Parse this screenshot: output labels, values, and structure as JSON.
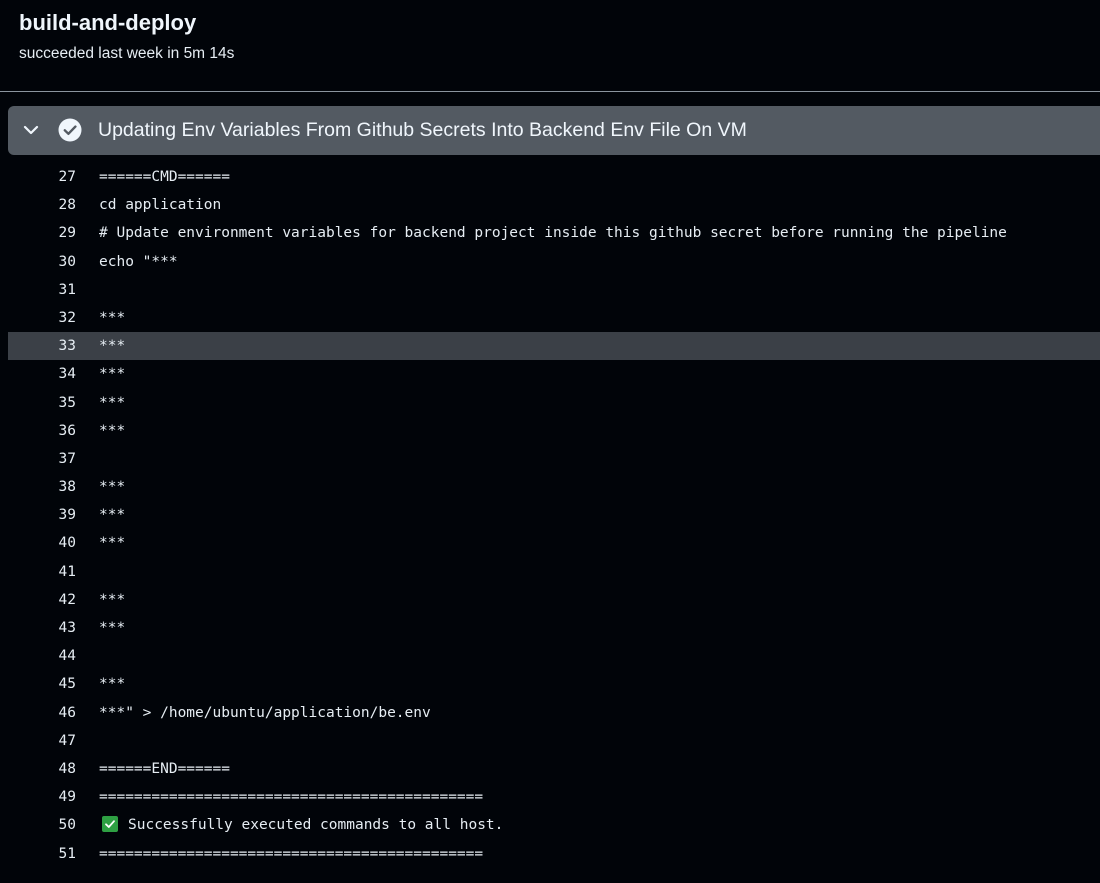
{
  "job": {
    "title": "build-and-deploy",
    "status": "succeeded last week in 5m 14s"
  },
  "step": {
    "title": "Updating Env Variables From Github Secrets Into Backend Env File On VM",
    "status_icon": "check-circle-icon",
    "expand_icon": "chevron-down-icon"
  },
  "colors": {
    "background": "#010409",
    "step_header": "#535a62",
    "highlight_row": "#3b4047",
    "success_green": "#2ea043"
  },
  "log": {
    "lines": [
      {
        "num": "27",
        "text": "======CMD======"
      },
      {
        "num": "28",
        "text": "cd application"
      },
      {
        "num": "29",
        "text": "# Update environment variables for backend project inside this github secret before running the pipeline"
      },
      {
        "num": "30",
        "text": "echo \"***"
      },
      {
        "num": "31",
        "text": ""
      },
      {
        "num": "32",
        "text": "***"
      },
      {
        "num": "33",
        "text": "***"
      },
      {
        "num": "34",
        "text": "***"
      },
      {
        "num": "35",
        "text": "***"
      },
      {
        "num": "36",
        "text": "***"
      },
      {
        "num": "37",
        "text": ""
      },
      {
        "num": "38",
        "text": "***"
      },
      {
        "num": "39",
        "text": "***"
      },
      {
        "num": "40",
        "text": "***"
      },
      {
        "num": "41",
        "text": ""
      },
      {
        "num": "42",
        "text": "***"
      },
      {
        "num": "43",
        "text": "***"
      },
      {
        "num": "44",
        "text": ""
      },
      {
        "num": "45",
        "text": "***"
      },
      {
        "num": "46",
        "text": "***\" > /home/ubuntu/application/be.env"
      },
      {
        "num": "47",
        "text": ""
      },
      {
        "num": "48",
        "text": "======END======"
      },
      {
        "num": "49",
        "text": "============================================"
      },
      {
        "num": "50",
        "text": "Successfully executed commands to all host."
      },
      {
        "num": "51",
        "text": "============================================"
      }
    ]
  }
}
